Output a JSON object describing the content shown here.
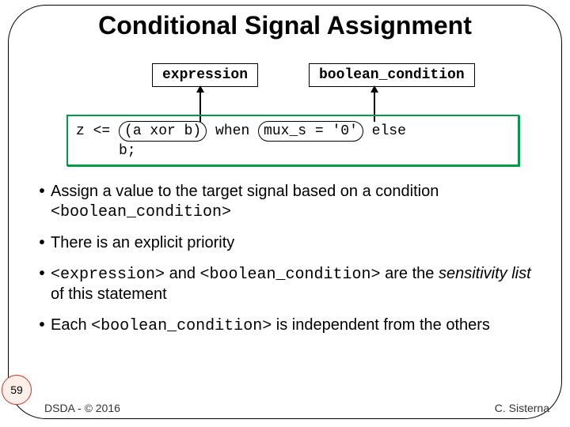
{
  "title": "Conditional Signal Assignment",
  "labels": {
    "expression": "expression",
    "boolean_condition": "boolean_condition"
  },
  "code": {
    "prefix": "z <= ",
    "ring1": "(a xor b)",
    "mid": " when ",
    "ring2": "mux_s = '0'",
    "suffix": " else",
    "line2": "     b;"
  },
  "bullets": [
    {
      "text_parts": [
        "Assign a value to the target signal based on a condition "
      ],
      "mono_after": "<boolean_condition>"
    },
    {
      "text_parts": [
        "There is an explicit priority"
      ]
    },
    {
      "mono_a": "<expression>",
      "text_mid1": " and ",
      "mono_b": "<boolean_condition>",
      "text_mid2": " are the ",
      "italic": "sensitivity list",
      "text_tail": "  of this statement"
    },
    {
      "text_parts": [
        "Each "
      ],
      "mono_a": "<boolean_condition>",
      "text_tail": " is independent from the others"
    }
  ],
  "page_number": "59",
  "footer": {
    "left": "DSDA - © 2016",
    "right": "C. Sisterna"
  }
}
